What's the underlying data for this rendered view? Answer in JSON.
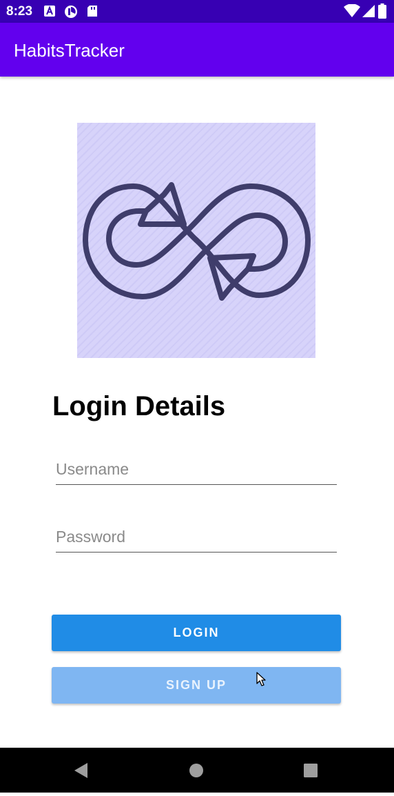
{
  "status_bar": {
    "time": "8:23",
    "left_icons": [
      "a-letter-icon",
      "pie-icon",
      "sd-card-icon"
    ],
    "right_icons": [
      "wifi-icon",
      "signal-icon",
      "battery-icon"
    ]
  },
  "app_bar": {
    "title": "HabitsTracker"
  },
  "logo": {
    "icon": "infinity-arrows-icon",
    "background_color": "#d7d3fa",
    "stroke_color": "#3f3d6b"
  },
  "login": {
    "heading": "Login Details",
    "username_placeholder": "Username",
    "password_placeholder": "Password",
    "login_label": "LOGIN",
    "signup_label": "SIGN UP"
  },
  "colors": {
    "status_bar": "#3700b3",
    "app_bar": "#6200ee",
    "login_button": "#208ce6",
    "signup_button": "#7fb6f2"
  },
  "nav_bar": {
    "buttons": [
      "back-icon",
      "home-icon",
      "recents-icon"
    ]
  }
}
